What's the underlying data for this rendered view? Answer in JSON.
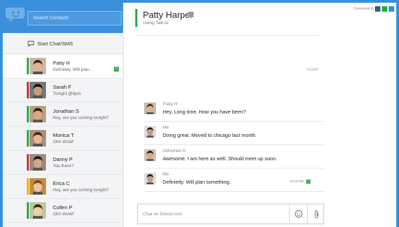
{
  "sidebar": {
    "search_placeholder": "Search Contacts",
    "start_chat_label": "Start Chat/SMS",
    "contacts": [
      {
        "name": "Patty H",
        "message": "Definitely. Will plan...",
        "status_color": "#2aa84a",
        "active": true,
        "tag": "C"
      },
      {
        "name": "Sarah F",
        "message": "Tonight @8pm",
        "status_color": "#c0392b"
      },
      {
        "name": "Jonathan S",
        "message": "Hey, are you coming tonight?",
        "status_color": "#2aa84a"
      },
      {
        "name": "Monica T",
        "message": "Ohh WoW!",
        "status_color": "#2aa84a"
      },
      {
        "name": "Danny P",
        "message": "You there?",
        "status_color": "#c0392b"
      },
      {
        "name": "Erica C",
        "message": "Hey, are you coming tonight?",
        "status_color": "#e8b400"
      },
      {
        "name": "Collen P",
        "message": "Ohh WoW!",
        "status_color": "#2aa84a"
      }
    ]
  },
  "header": {
    "title": "Patty Harper",
    "subtitle": "Using Talk.to",
    "connected_label": "Connected to"
  },
  "chat": {
    "day_label": "TODAY",
    "messages": [
      {
        "sender": "Patty H",
        "text": "Hey, Long time. How you have been?"
      },
      {
        "sender": "Me",
        "text": "Doing great. Moved to chicago last month."
      },
      {
        "sender": "Abhishek G",
        "text": "Awesome. I am here as well. Should meet up soon."
      },
      {
        "sender": "Me",
        "text": "Definietly. Will plan something.",
        "time": "11:12 PM",
        "tag": "C"
      }
    ]
  },
  "composer": {
    "placeholder": "Chat on Directi.com"
  },
  "colors": {
    "accent": "#3b8fdb",
    "online": "#2aa84a",
    "busy": "#c0392b",
    "away": "#e8b400"
  },
  "icons": [
    "chat-logo-icon",
    "chat-bubble-icon",
    "smiley-icon",
    "paperclip-icon",
    "facebook-icon",
    "gtalk-icon",
    "talkto-icon"
  ]
}
